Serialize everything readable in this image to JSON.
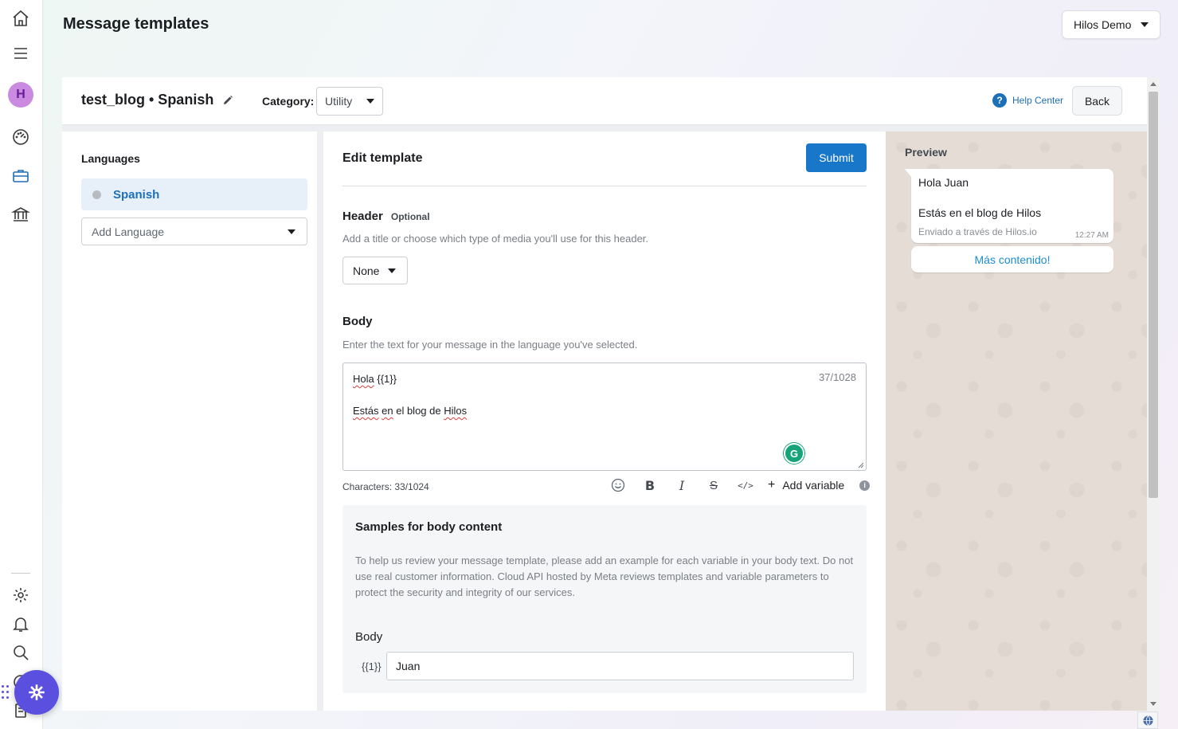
{
  "page": {
    "title": "Message templates"
  },
  "account": {
    "selected": "Hilos Demo"
  },
  "rail": {
    "avatar_letter": "H",
    "icons": [
      "home-icon",
      "menu-icon",
      "dashboard-icon",
      "briefcase-icon",
      "bank-icon",
      "gear-icon",
      "bell-icon",
      "search-icon",
      "chat-icon",
      "document-icon"
    ]
  },
  "template": {
    "name": "test_blog • Spanish",
    "category_label": "Category:",
    "category_value": "Utility",
    "help_center": "Help Center",
    "back": "Back"
  },
  "languages": {
    "title": "Languages",
    "items": [
      {
        "label": "Spanish"
      }
    ],
    "add_placeholder": "Add Language"
  },
  "editor": {
    "title": "Edit template",
    "submit": "Submit",
    "header": {
      "title": "Header",
      "optional": "Optional",
      "help": "Add a title or choose which type of media you'll use for this header.",
      "media_value": "None"
    },
    "body": {
      "title": "Body",
      "help": "Enter the text for your message in the language you've selected.",
      "line1_word1": "Hola",
      "line1_rest": " {{1}}",
      "line2_word1": "Estás",
      "line2_word2": "en",
      "line2_mid": " el blog de ",
      "line2_word3": "Hilos",
      "counter": "37/1028",
      "grammarly": "G",
      "characters": "Characters: 33/1024"
    },
    "toolbar": {
      "bold": "B",
      "italic": "I",
      "strike": "S",
      "code": "</>",
      "add_variable": "Add variable",
      "plus": "+"
    },
    "samples": {
      "title": "Samples for body content",
      "description": "To help us review your message template, please add an example for each variable in your body text. Do not use real customer information. Cloud API hosted by Meta reviews templates and variable parameters to protect the security and integrity of our services.",
      "body_label": "Body",
      "variable_label": "{{1}}",
      "variable_value": "Juan"
    }
  },
  "preview": {
    "title": "Preview",
    "line1": "Hola Juan",
    "line2": "Estás en el blog de Hilos",
    "footer": "Enviado a través de Hilos.io",
    "time": "12:27 AM",
    "quick_reply": "Más contenido!"
  }
}
